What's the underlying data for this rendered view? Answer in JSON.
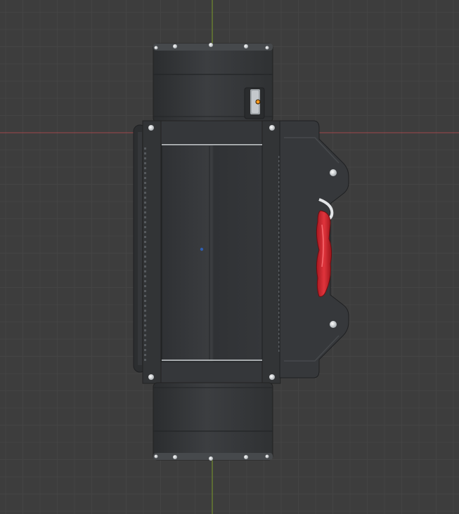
{
  "viewport": {
    "background_color": "#3d3d3d",
    "grid_minor_color": "#444444",
    "grid_major_color": "#4a4a4a",
    "x_axis_color": "#a0484c",
    "y_axis_color": "#7a9a2a",
    "origin_marker_color": "#2f5fb0"
  },
  "model": {
    "description_icon": "winch-model-icon",
    "body_color": "#3a3c3e",
    "body_dark_color": "#2e3032",
    "body_edge_color": "#52565a",
    "bolt_color": "#cdd2d6",
    "hook_color": "#d32630",
    "hook_highlight_color": "#f05258",
    "rope_color": "#e0e2e4",
    "light_indicator_color": "#ff9a1f"
  }
}
